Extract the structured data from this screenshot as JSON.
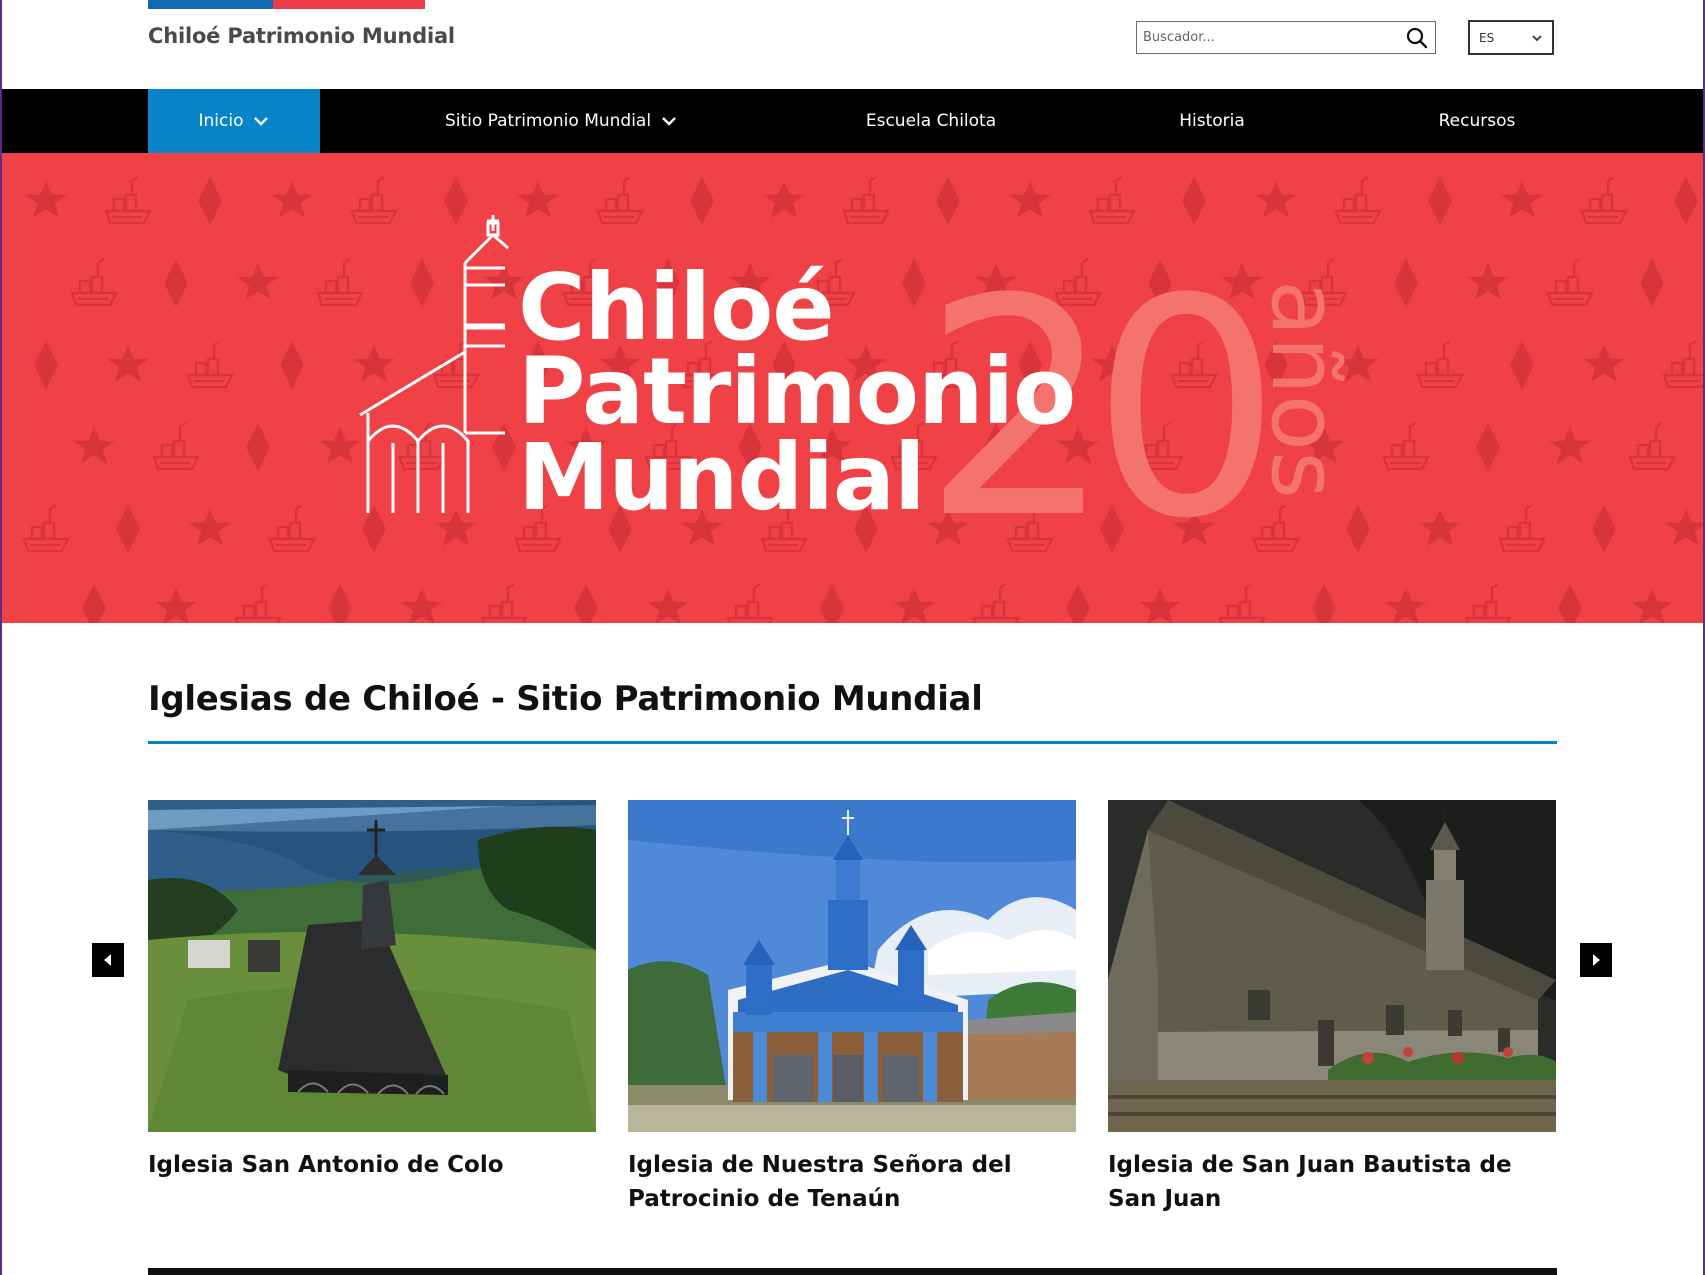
{
  "header": {
    "site_title": "Chiloé Patrimonio Mundial",
    "search": {
      "placeholder": "Buscador...",
      "value": ""
    },
    "search_icon": "search-icon",
    "language": {
      "selected": "ES",
      "icon": "chevron-down-icon"
    }
  },
  "nav": {
    "items": [
      {
        "label": "Inicio",
        "active": true,
        "has_dropdown": true
      },
      {
        "label": "Sitio Patrimonio Mundial",
        "active": false,
        "has_dropdown": true
      },
      {
        "label": "Escuela Chilota",
        "active": false,
        "has_dropdown": false
      },
      {
        "label": "Historia",
        "active": false,
        "has_dropdown": false
      },
      {
        "label": "Recursos",
        "active": false,
        "has_dropdown": false
      }
    ]
  },
  "banner": {
    "line1": "Chiloé",
    "line2": "Patrimonio",
    "line3": "Mundial",
    "number": "20",
    "years": "años",
    "logo_icon": "church-icon",
    "pattern_icons": [
      "star-icon",
      "diamond-icon",
      "boat-icon"
    ]
  },
  "section": {
    "title": "Iglesias de Chiloé - Sitio Patrimonio Mundial"
  },
  "carousel": {
    "prev_icon": "chevron-left-icon",
    "next_icon": "chevron-right-icon",
    "cards": [
      {
        "title": "Iglesia San Antonio de Colo",
        "image": "church-aerial-photo"
      },
      {
        "title": "Iglesia de Nuestra Señora del Patrocinio de Tenaún",
        "image": "blue-church-photo"
      },
      {
        "title": "Iglesia de San Juan Bautista de San Juan",
        "image": "wooden-church-photo"
      }
    ]
  },
  "colors": {
    "brand_blue": "#0a84c8",
    "banner_red": "#ef4146",
    "nav_bg": "#000000",
    "gov_blue": "#0f69b4",
    "gov_red": "#eb3c46"
  }
}
